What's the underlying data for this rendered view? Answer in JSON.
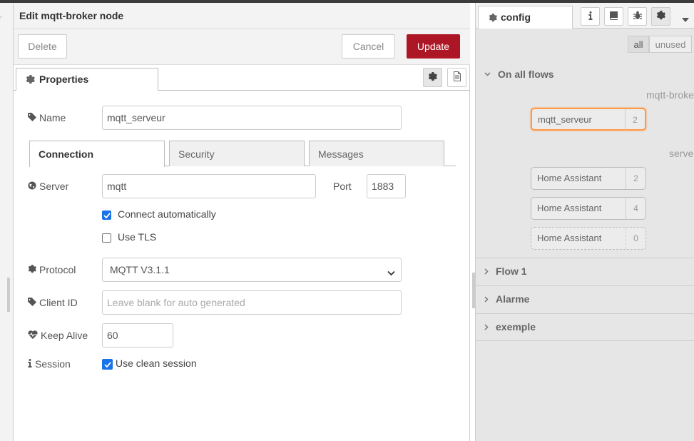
{
  "workspace": {
    "partial_text": "r"
  },
  "editor": {
    "title": "Edit mqtt-broker node",
    "buttons": {
      "delete": "Delete",
      "cancel": "Cancel",
      "update": "Update"
    },
    "tab": {
      "label": "Properties"
    },
    "fields": {
      "name": {
        "label": "Name",
        "value": "mqtt_serveur"
      },
      "server": {
        "label": "Server",
        "value": "mqtt"
      },
      "port": {
        "label": "Port",
        "value": "1883"
      },
      "connect_auto": {
        "label": "Connect automatically",
        "checked": true
      },
      "use_tls": {
        "label": "Use TLS",
        "checked": false
      },
      "protocol": {
        "label": "Protocol",
        "value": "MQTT V3.1.1"
      },
      "client_id": {
        "label": "Client ID",
        "placeholder": "Leave blank for auto generated"
      },
      "keep_alive": {
        "label": "Keep Alive",
        "value": "60"
      },
      "session": {
        "label": "Session",
        "option_label": "Use clean session",
        "checked": true
      }
    },
    "conn_tabs": [
      "Connection",
      "Security",
      "Messages"
    ]
  },
  "sidebar": {
    "tab_label": "config",
    "filters": {
      "all": "all",
      "unused": "unused"
    },
    "sections": {
      "on_all_flows": "On all flows",
      "flow1": "Flow 1",
      "alarme": "Alarme",
      "exemple": "exemple"
    },
    "type_labels": {
      "broker": "mqtt-broker",
      "server": "server"
    },
    "nodes": [
      {
        "label": "mqtt_serveur",
        "count": "2"
      },
      {
        "label": "Home Assistant",
        "count": "2"
      },
      {
        "label": "Home Assistant",
        "count": "4"
      },
      {
        "label": "Home Assistant",
        "count": "0"
      }
    ]
  },
  "colors": {
    "update": "#ad1625",
    "selected": "#ff9a4a",
    "checkbox": "#1a73e8"
  }
}
